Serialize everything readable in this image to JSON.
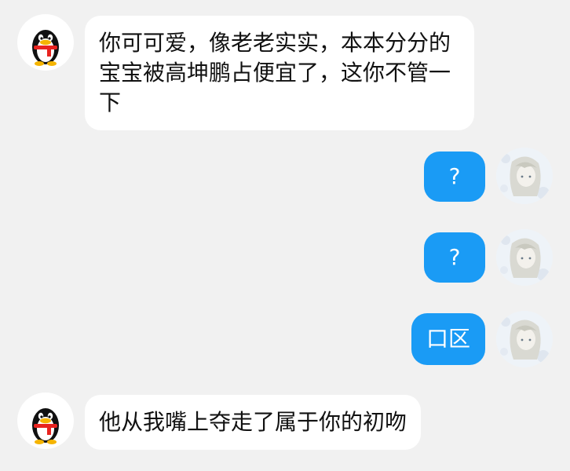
{
  "accent_color": "#1a9bf5",
  "messages": [
    {
      "sender": "other",
      "avatar": "qq-penguin-avatar",
      "text": "你可可爱，像老老实实，本本分分的宝宝被高坤鹏占便宜了，这你不管一下"
    },
    {
      "sender": "self",
      "avatar": "anime-girl-avatar",
      "text": "?"
    },
    {
      "sender": "self",
      "avatar": "anime-girl-avatar",
      "text": "?"
    },
    {
      "sender": "self",
      "avatar": "anime-girl-avatar",
      "text": "口区"
    },
    {
      "sender": "other",
      "avatar": "qq-penguin-avatar",
      "text": "他从我嘴上夺走了属于你的初吻"
    }
  ]
}
